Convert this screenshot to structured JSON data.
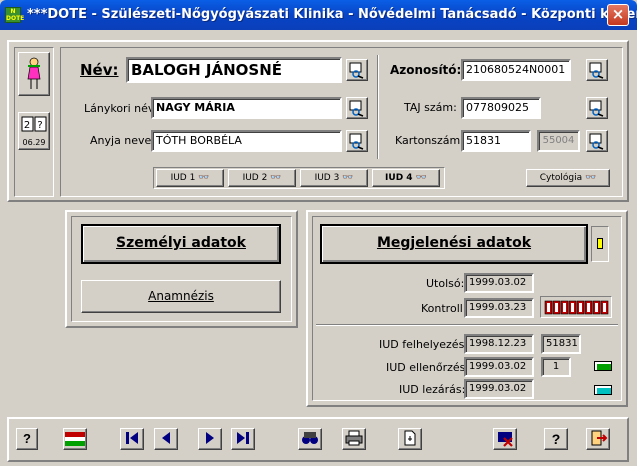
{
  "window": {
    "title": "***DOTE - Szülészeti-Nőgyógyászati Klinika - Nővédelmi Tanácsadó - Központi képernyő",
    "close": "×",
    "icon_text": "N\nDOTE"
  },
  "patient": {
    "date_badge": "06.29",
    "name_label": "Név:",
    "name": "BALOGH JÁNOSNÉ",
    "maiden_label": "Lánykori név:",
    "maiden": "NAGY MÁRIA",
    "mother_label": "Anyja neve:",
    "mother": "TÓTH BORBÉLA",
    "id_label": "Azonosító:",
    "id": "210680524N0001",
    "taj_label": "TAJ szám:",
    "taj": "077809025",
    "card_label": "Kartonszám:",
    "card": "51831",
    "card_extra": "55004"
  },
  "iud_buttons": [
    "IUD 1",
    "IUD 2",
    "IUD 3",
    "IUD 4"
  ],
  "cytology": "Cytológia",
  "left_buttons": {
    "personal": "Személyi adatok",
    "anamnesis": "Anamnézis"
  },
  "appearance": {
    "title": "Megjelenési adatok",
    "last_label": "Utolsó:",
    "last": "1999.03.02",
    "control_label": "Kontroll:",
    "control": "1999.03.23",
    "iud_insert_label": "IUD felhelyezés:",
    "iud_insert": "1998.12.23",
    "iud_insert_no": "51831",
    "iud_check_label": "IUD ellenőrzés:",
    "iud_check": "1999.03.02",
    "iud_check_no": "1",
    "iud_close_label": "IUD lezárás:",
    "iud_close": "1999.03.02"
  },
  "toolbar": {
    "help": "?",
    "help2": "?"
  },
  "colors": {
    "accent_red": "#c00000",
    "green": "#00a000",
    "cyan": "#00c0c0",
    "yellow": "#ffff00"
  }
}
